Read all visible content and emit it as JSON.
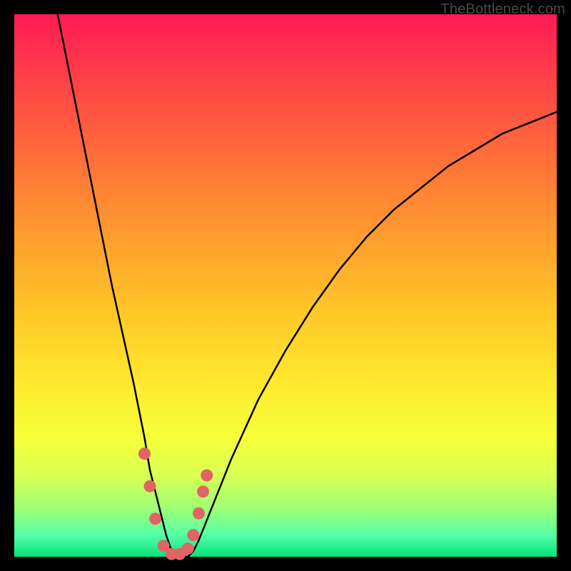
{
  "watermark": "TheBottleneck.com",
  "chart_data": {
    "type": "line",
    "title": "",
    "xlabel": "",
    "ylabel": "",
    "xlim": [
      0,
      100
    ],
    "ylim": [
      0,
      100
    ],
    "grid": false,
    "series": [
      {
        "name": "bottleneck-curve",
        "x": [
          8,
          10,
          12,
          14,
          16,
          18,
          20,
          22,
          24,
          25,
          26,
          27,
          28,
          29,
          30,
          31,
          32,
          33,
          34,
          36,
          40,
          45,
          50,
          55,
          60,
          65,
          70,
          75,
          80,
          85,
          90,
          95,
          100
        ],
        "y": [
          100,
          90,
          80,
          70,
          60,
          50,
          41,
          32,
          22,
          16,
          12,
          8,
          4,
          1,
          0,
          0,
          0,
          1,
          3,
          8,
          18,
          29,
          38,
          46,
          53,
          59,
          64,
          68,
          72,
          75,
          78,
          80,
          82
        ]
      }
    ],
    "markers": [
      {
        "x": 24.0,
        "y": 19
      },
      {
        "x": 25.0,
        "y": 13
      },
      {
        "x": 26.0,
        "y": 7
      },
      {
        "x": 27.5,
        "y": 2
      },
      {
        "x": 29.0,
        "y": 0.5
      },
      {
        "x": 30.5,
        "y": 0.5
      },
      {
        "x": 32.0,
        "y": 1.5
      },
      {
        "x": 33.0,
        "y": 4
      },
      {
        "x": 34.0,
        "y": 8
      },
      {
        "x": 34.8,
        "y": 12
      },
      {
        "x": 35.5,
        "y": 15
      }
    ],
    "marker_color": "#e06464",
    "line_color": "#000000"
  }
}
